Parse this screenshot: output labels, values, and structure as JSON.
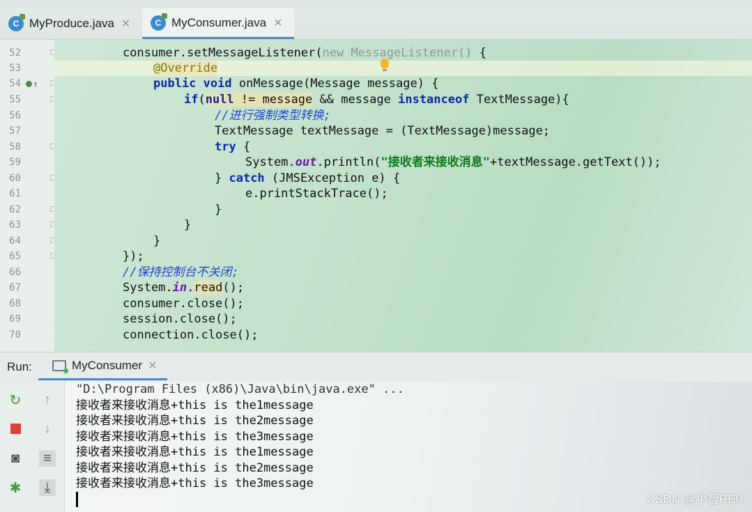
{
  "tabs": [
    {
      "label": "MyProduce.java",
      "icon": "C",
      "active": false
    },
    {
      "label": "MyConsumer.java",
      "icon": "C",
      "active": true
    }
  ],
  "editor": {
    "line_numbers": [
      "52",
      "53",
      "54",
      "55",
      "56",
      "57",
      "58",
      "59",
      "60",
      "61",
      "62",
      "63",
      "64",
      "65",
      "66",
      "67",
      "68",
      "69",
      "70"
    ],
    "code": {
      "l52_a": "consumer.setMessageListener(",
      "l52_new": "new",
      "l52_anon": " MessageListener()",
      "l52_b": " {",
      "l53_ann": "@Override",
      "l54_public": "public",
      "l54_void": "void",
      "l54_rest": " onMessage(Message message) {",
      "l55_if": "if",
      "l55_b": "(",
      "l55_null": "null",
      "l55_cmp": " != message",
      "l55_c": " && message ",
      "l55_inst": "instanceof",
      "l55_d": " TextMessage){",
      "l56_cm": "//进行强制类型转换;",
      "l57": "TextMessage textMessage = (TextMessage)message;",
      "l58_try": "try",
      "l58_b": " {",
      "l59_a": "System.",
      "l59_out": "out",
      "l59_b": ".println(",
      "l59_str": "\"接收者来接收消息\"",
      "l59_c": "+textMessage.getText());",
      "l60_a": "} ",
      "l60_catch": "catch",
      "l60_b": " (JMSException e) {",
      "l61": "e.printStackTrace();",
      "l62": "}",
      "l63": "}",
      "l64": "}",
      "l65": "});",
      "l66_cm": "//保持控制台不关闭;",
      "l67_a": "System.",
      "l67_in": "in",
      "l67_b": ".",
      "l67_read": "read",
      "l67_c": "();",
      "l68": "consumer.close();",
      "l69": "session.close();",
      "l70": "connection.close();"
    }
  },
  "run": {
    "label": "Run:",
    "tab_label": "MyConsumer"
  },
  "console": {
    "command": "\"D:\\Program Files (x86)\\Java\\bin\\java.exe\" ...",
    "lines": [
      "接收者来接收消息+this is the1message",
      "接收者来接收消息+this is the2message",
      "接收者来接收消息+this is the3message",
      "接收者来接收消息+this is the1message",
      "接收者来接收消息+this is the2message",
      "接收者来接收消息+this is the3message"
    ]
  },
  "watermark": "CSDN @小智RE0",
  "colors": {
    "keyword": "#0b2aa8",
    "comment": "#1f47c9",
    "string": "#0c7a1a",
    "accent": "#4a88c7"
  }
}
